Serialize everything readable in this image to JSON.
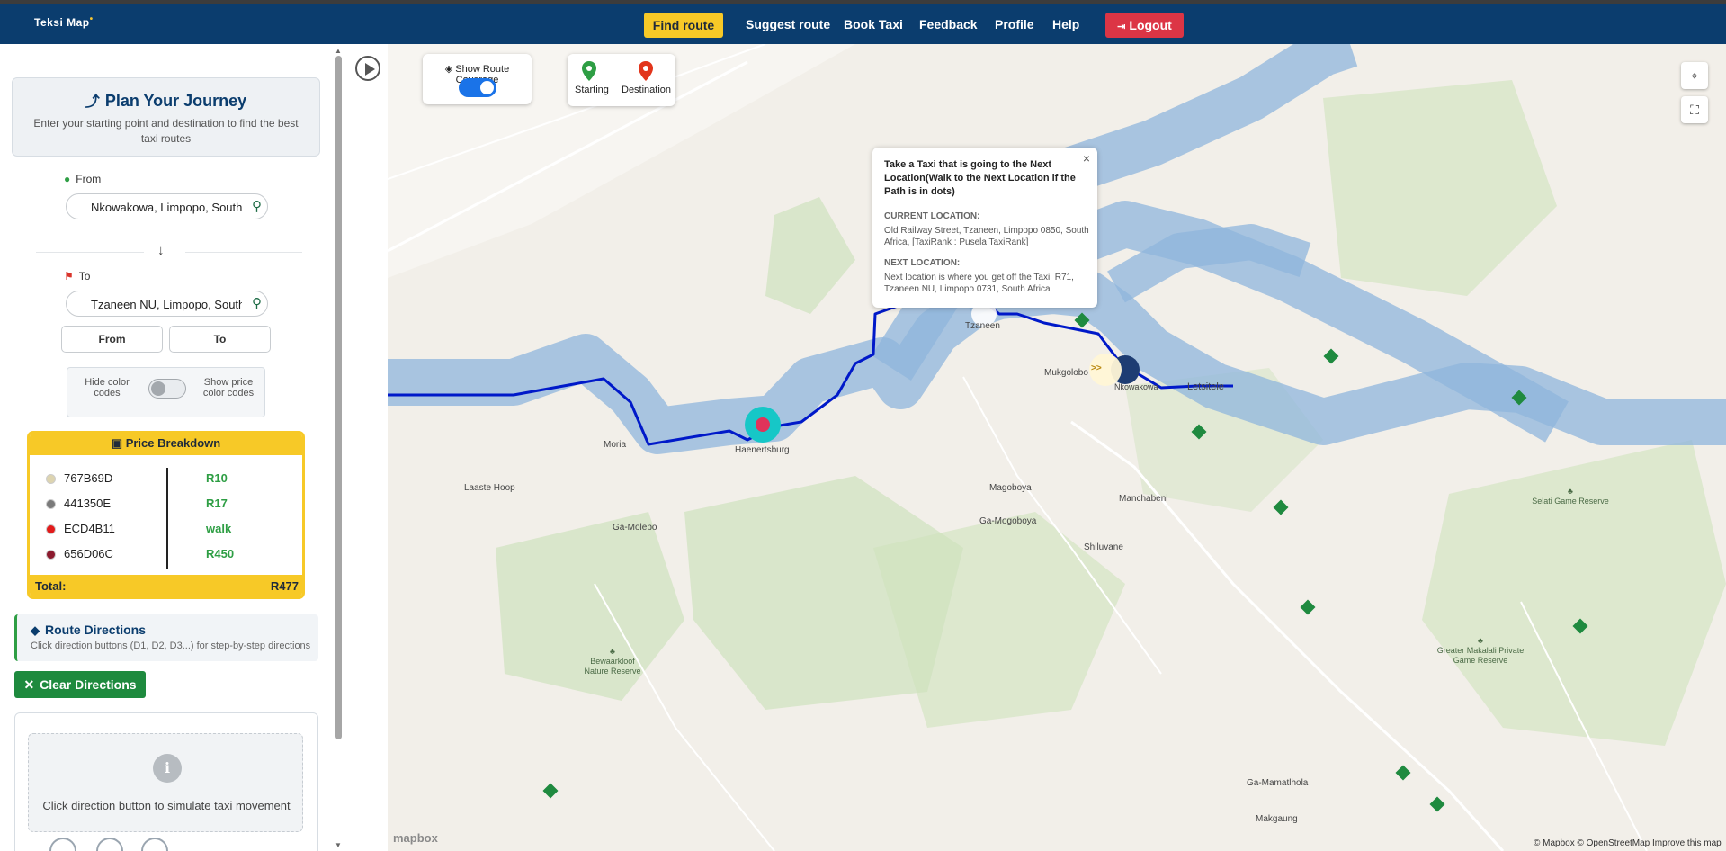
{
  "navbar": {
    "logo": "Teksi Map",
    "items": {
      "find_route": "Find route",
      "suggest_route": "Suggest route",
      "book_taxi": "Book Taxi",
      "feedback": "Feedback",
      "profile": "Profile",
      "help": "Help",
      "logout": "Logout"
    },
    "colors": {
      "background": "#0b3d6e",
      "find_button": "#f7c927",
      "logout_button": "#dc3545"
    }
  },
  "planner": {
    "title": "Plan Your Journey",
    "subtitle": "Enter your starting point and destination to find the best taxi routes",
    "from_label": "From",
    "from_value": "Nkowakowa, Limpopo, South Africa",
    "to_label": "To",
    "to_value": "Tzaneen NU, Limpopo, South Africa",
    "from_button": "From",
    "to_button": "To",
    "hide_color_codes": "Hide color codes",
    "show_price_color_codes": "Show price color codes"
  },
  "price_breakdown": {
    "title": "Price Breakdown",
    "rows": [
      {
        "code": "767B69D",
        "amount": "R10",
        "color": "#ddd4b0"
      },
      {
        "code": "441350E",
        "amount": "R17",
        "color": "#7a7a7a"
      },
      {
        "code": "ECD4B11",
        "amount": "walk",
        "color": "#e21b1b"
      },
      {
        "code": "656D06C",
        "amount": "R450",
        "color": "#8b1a2e"
      }
    ],
    "total_label": "Total:",
    "total_value": "R477"
  },
  "directions": {
    "title": "Route Directions",
    "subtitle": "Click direction buttons (D1, D2, D3...) for step-by-step directions",
    "clear_button": "Clear Directions",
    "simulate_message": "Click direction button to simulate taxi movement"
  },
  "map": {
    "show_route_coverage": "Show Route Coverage",
    "legend": {
      "starting": "Starting",
      "destination": "Destination"
    },
    "popup": {
      "title": "Take a Taxi that is going to the Next Location(Walk to the Next Location if the Path is in dots)",
      "current_heading": "CURRENT LOCATION:",
      "current_text": "Old Railway Street, Tzaneen, Limpopo 0850, South Africa, [TaxiRank : Pusela TaxiRank]",
      "next_heading": "NEXT LOCATION:",
      "next_text": "Next location is where you get off the Taxi: R71, Tzaneen NU, Limpopo 0731, South Africa",
      "close": "×"
    },
    "places": {
      "laaste_hoop": "Laaste Hoop",
      "ga_molepo": "Ga-Molepo",
      "moria": "Moria",
      "haenertsburg": "Haenertsburg",
      "tzaneen": "Tzaneen",
      "mukgolo": "Mukgolobo",
      "nkowakowa": "Nkowakowa",
      "letsitele": "Letsitele",
      "magoboya": "Magoboya",
      "ga_mogoboya": "Ga-Mogoboya",
      "manchabeni": "Manchabeni",
      "shiluvane": "Shiluvane",
      "selati": "Selati Game Reserve",
      "greater_makalali": "Greater Makalali Private Game Reserve",
      "bewaarkloof": "Bewaarkloof Nature Reserve",
      "ga_mamatlhola": "Ga-Mamatlhola",
      "makgaung": "Makgaung"
    },
    "attribution": "© Mapbox © OpenStreetMap  Improve this map",
    "mapbox_logo": "mapbox",
    "marker_arrows": ">>"
  }
}
